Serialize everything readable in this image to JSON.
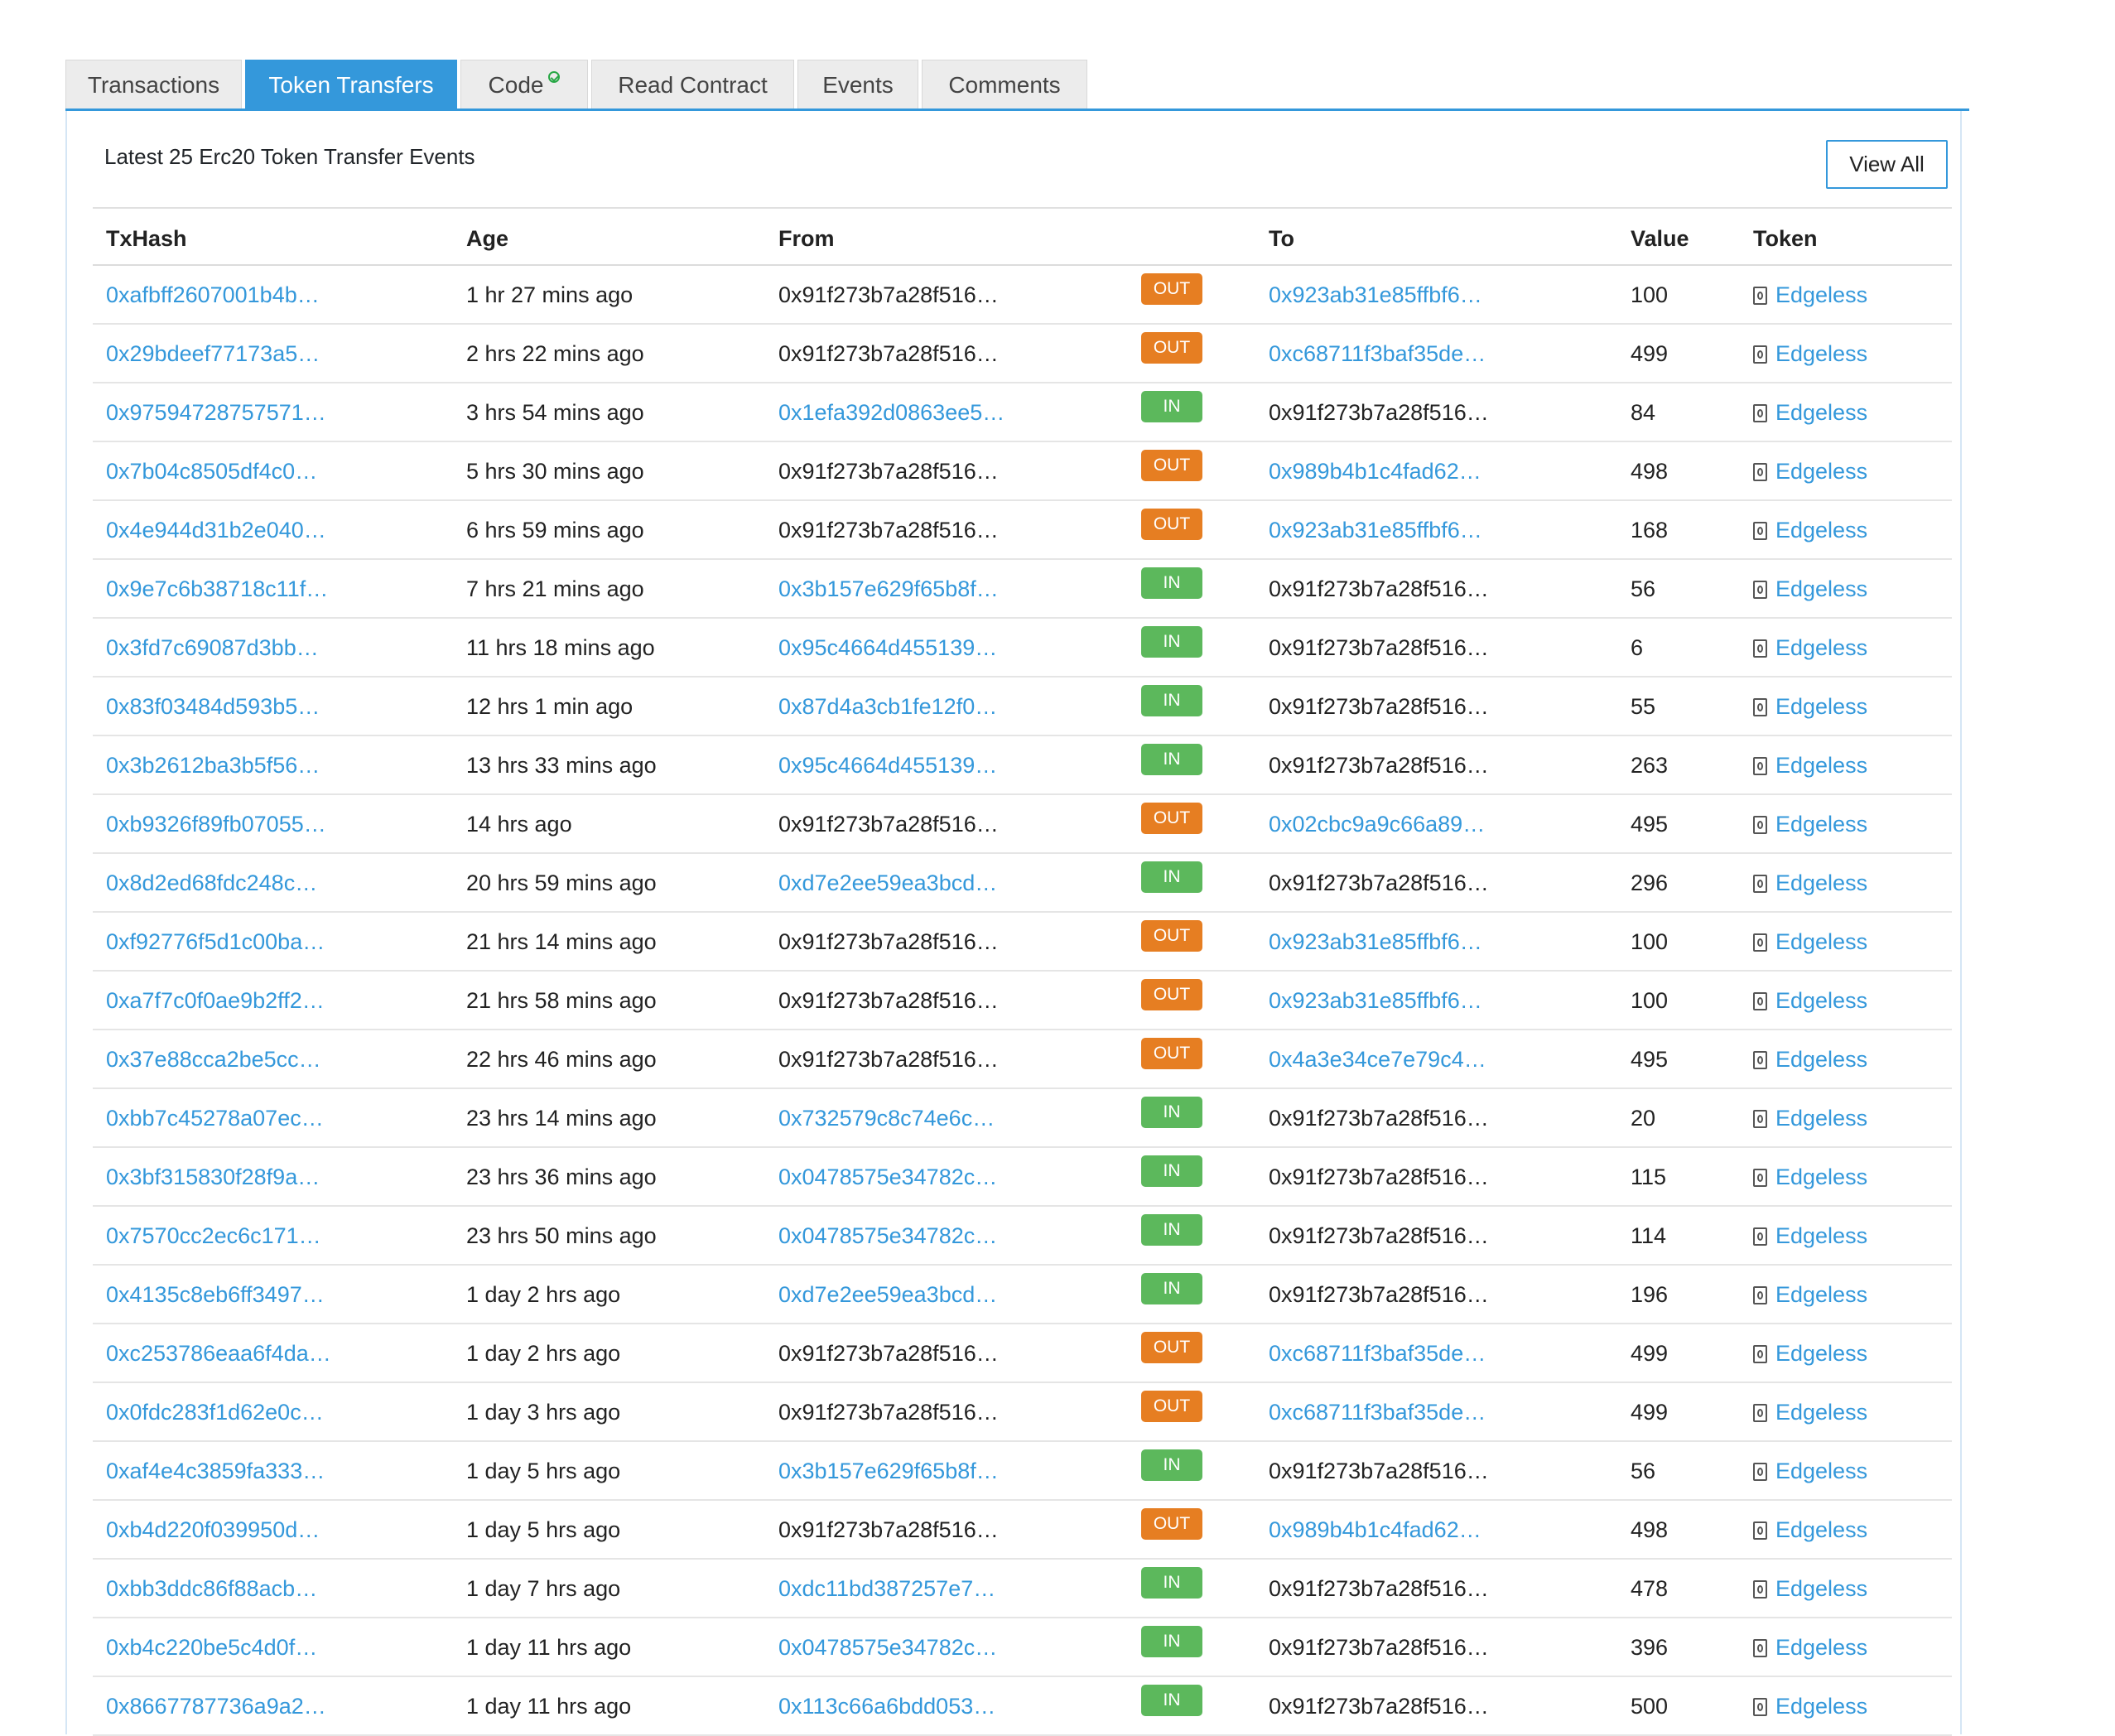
{
  "tabs": [
    {
      "label": "Transactions",
      "active": false
    },
    {
      "label": "Token Transfers",
      "active": true
    },
    {
      "label": "Code",
      "active": false,
      "verified": true
    },
    {
      "label": "Read Contract",
      "active": false
    },
    {
      "label": "Events",
      "active": false
    },
    {
      "label": "Comments",
      "active": false
    }
  ],
  "panel": {
    "caption": "Latest 25 Erc20 Token Transfer Events",
    "view_all_label": "View All"
  },
  "table": {
    "headers": {
      "txhash": "TxHash",
      "age": "Age",
      "from": "From",
      "to": "To",
      "value": "Value",
      "token": "Token"
    },
    "rows": [
      {
        "tx": "0xafbff2607001b4b…",
        "age": "1 hr 27 mins ago",
        "from": "0x91f273b7a28f516…",
        "dir": "OUT",
        "to": "0x923ab31e85ffbf6…",
        "value": "100",
        "token": "Edgeless"
      },
      {
        "tx": "0x29bdeef77173a5…",
        "age": "2 hrs 22 mins ago",
        "from": "0x91f273b7a28f516…",
        "dir": "OUT",
        "to": "0xc68711f3baf35de…",
        "value": "499",
        "token": "Edgeless"
      },
      {
        "tx": "0x97594728757571…",
        "age": "3 hrs 54 mins ago",
        "from": "0x1efa392d0863ee5…",
        "dir": "IN",
        "to": "0x91f273b7a28f516…",
        "value": "84",
        "token": "Edgeless"
      },
      {
        "tx": "0x7b04c8505df4c0…",
        "age": "5 hrs 30 mins ago",
        "from": "0x91f273b7a28f516…",
        "dir": "OUT",
        "to": "0x989b4b1c4fad62…",
        "value": "498",
        "token": "Edgeless"
      },
      {
        "tx": "0x4e944d31b2e040…",
        "age": "6 hrs 59 mins ago",
        "from": "0x91f273b7a28f516…",
        "dir": "OUT",
        "to": "0x923ab31e85ffbf6…",
        "value": "168",
        "token": "Edgeless"
      },
      {
        "tx": "0x9e7c6b38718c11f…",
        "age": "7 hrs 21 mins ago",
        "from": "0x3b157e629f65b8f…",
        "dir": "IN",
        "to": "0x91f273b7a28f516…",
        "value": "56",
        "token": "Edgeless"
      },
      {
        "tx": "0x3fd7c69087d3bb…",
        "age": "11 hrs 18 mins ago",
        "from": "0x95c4664d455139…",
        "dir": "IN",
        "to": "0x91f273b7a28f516…",
        "value": "6",
        "token": "Edgeless"
      },
      {
        "tx": "0x83f03484d593b5…",
        "age": "12 hrs 1 min ago",
        "from": "0x87d4a3cb1fe12f0…",
        "dir": "IN",
        "to": "0x91f273b7a28f516…",
        "value": "55",
        "token": "Edgeless"
      },
      {
        "tx": "0x3b2612ba3b5f56…",
        "age": "13 hrs 33 mins ago",
        "from": "0x95c4664d455139…",
        "dir": "IN",
        "to": "0x91f273b7a28f516…",
        "value": "263",
        "token": "Edgeless"
      },
      {
        "tx": "0xb9326f89fb07055…",
        "age": "14 hrs ago",
        "from": "0x91f273b7a28f516…",
        "dir": "OUT",
        "to": "0x02cbc9a9c66a89…",
        "value": "495",
        "token": "Edgeless"
      },
      {
        "tx": "0x8d2ed68fdc248c…",
        "age": "20 hrs 59 mins ago",
        "from": "0xd7e2ee59ea3bcd…",
        "dir": "IN",
        "to": "0x91f273b7a28f516…",
        "value": "296",
        "token": "Edgeless"
      },
      {
        "tx": "0xf92776f5d1c00ba…",
        "age": "21 hrs 14 mins ago",
        "from": "0x91f273b7a28f516…",
        "dir": "OUT",
        "to": "0x923ab31e85ffbf6…",
        "value": "100",
        "token": "Edgeless"
      },
      {
        "tx": "0xa7f7c0f0ae9b2ff2…",
        "age": "21 hrs 58 mins ago",
        "from": "0x91f273b7a28f516…",
        "dir": "OUT",
        "to": "0x923ab31e85ffbf6…",
        "value": "100",
        "token": "Edgeless"
      },
      {
        "tx": "0x37e88cca2be5cc…",
        "age": "22 hrs 46 mins ago",
        "from": "0x91f273b7a28f516…",
        "dir": "OUT",
        "to": "0x4a3e34ce7e79c4…",
        "value": "495",
        "token": "Edgeless"
      },
      {
        "tx": "0xbb7c45278a07ec…",
        "age": "23 hrs 14 mins ago",
        "from": "0x732579c8c74e6c…",
        "dir": "IN",
        "to": "0x91f273b7a28f516…",
        "value": "20",
        "token": "Edgeless"
      },
      {
        "tx": "0x3bf315830f28f9a…",
        "age": "23 hrs 36 mins ago",
        "from": "0x0478575e34782c…",
        "dir": "IN",
        "to": "0x91f273b7a28f516…",
        "value": "115",
        "token": "Edgeless"
      },
      {
        "tx": "0x7570cc2ec6c171…",
        "age": "23 hrs 50 mins ago",
        "from": "0x0478575e34782c…",
        "dir": "IN",
        "to": "0x91f273b7a28f516…",
        "value": "114",
        "token": "Edgeless"
      },
      {
        "tx": "0x4135c8eb6ff3497…",
        "age": "1 day 2 hrs ago",
        "from": "0xd7e2ee59ea3bcd…",
        "dir": "IN",
        "to": "0x91f273b7a28f516…",
        "value": "196",
        "token": "Edgeless"
      },
      {
        "tx": "0xc253786eaa6f4da…",
        "age": "1 day 2 hrs ago",
        "from": "0x91f273b7a28f516…",
        "dir": "OUT",
        "to": "0xc68711f3baf35de…",
        "value": "499",
        "token": "Edgeless"
      },
      {
        "tx": "0x0fdc283f1d62e0c…",
        "age": "1 day 3 hrs ago",
        "from": "0x91f273b7a28f516…",
        "dir": "OUT",
        "to": "0xc68711f3baf35de…",
        "value": "499",
        "token": "Edgeless"
      },
      {
        "tx": "0xaf4e4c3859fa333…",
        "age": "1 day 5 hrs ago",
        "from": "0x3b157e629f65b8f…",
        "dir": "IN",
        "to": "0x91f273b7a28f516…",
        "value": "56",
        "token": "Edgeless"
      },
      {
        "tx": "0xb4d220f039950d…",
        "age": "1 day 5 hrs ago",
        "from": "0x91f273b7a28f516…",
        "dir": "OUT",
        "to": "0x989b4b1c4fad62…",
        "value": "498",
        "token": "Edgeless"
      },
      {
        "tx": "0xbb3ddc86f88acb…",
        "age": "1 day 7 hrs ago",
        "from": "0xdc11bd387257e7…",
        "dir": "IN",
        "to": "0x91f273b7a28f516…",
        "value": "478",
        "token": "Edgeless"
      },
      {
        "tx": "0xb4c220be5c4d0f…",
        "age": "1 day 11 hrs ago",
        "from": "0x0478575e34782c…",
        "dir": "IN",
        "to": "0x91f273b7a28f516…",
        "value": "396",
        "token": "Edgeless"
      },
      {
        "tx": "0x8667787736a9a2…",
        "age": "1 day 11 hrs ago",
        "from": "0x113c66a6bdd053…",
        "dir": "IN",
        "to": "0x91f273b7a28f516…",
        "value": "500",
        "token": "Edgeless"
      }
    ]
  },
  "colors": {
    "accent": "#3498db",
    "out_badge": "#e67e22",
    "in_badge": "#5cb85c"
  },
  "icons": {
    "token": "token-contract-icon",
    "verified": "verified-check-icon"
  }
}
